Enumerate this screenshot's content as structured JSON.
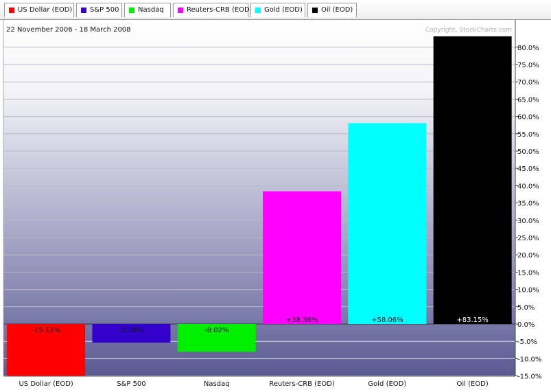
{
  "legend": [
    {
      "label": "US Dollar (EOD)",
      "color": "#ff0000"
    },
    {
      "label": "S&P 500",
      "color": "#3300cc"
    },
    {
      "label": "Nasdaq",
      "color": "#00ee00"
    },
    {
      "label": "Reuters-CRB (EOD)",
      "color": "#ff00ff"
    },
    {
      "label": "Gold (EOD)",
      "color": "#00ffff"
    },
    {
      "label": "Oil (EOD)",
      "color": "#000000"
    }
  ],
  "date_range": "22 November 2006 - 18 March 2008",
  "copyright": "Copyright, StockCharts.com",
  "chart_data": {
    "type": "bar",
    "categories": [
      "US Dollar (EOD)",
      "S&P 500",
      "Nasdaq",
      "Reuters-CRB (EOD)",
      "Gold (EOD)",
      "Oil (EOD)"
    ],
    "values": [
      -15.12,
      -5.36,
      -8.02,
      38.36,
      58.06,
      83.15
    ],
    "value_labels": [
      "-15.12%",
      "-5.36%",
      "-8.02%",
      "+38.36%",
      "+58.06%",
      "+83.15%"
    ],
    "colors": [
      "#ff0000",
      "#3300cc",
      "#00ee00",
      "#ff00ff",
      "#00ffff",
      "#000000"
    ],
    "yticks": [
      -15,
      -10,
      -5,
      0,
      5,
      10,
      15,
      20,
      25,
      30,
      35,
      40,
      45,
      50,
      55,
      60,
      65,
      70,
      75,
      80
    ],
    "ytick_labels": [
      "-15.0%",
      "-10.0%",
      "-5.0%",
      "0.0%",
      "5.0%",
      "10.0%",
      "15.0%",
      "20.0%",
      "25.0%",
      "30.0%",
      "35.0%",
      "40.0%",
      "45.0%",
      "50.0%",
      "55.0%",
      "60.0%",
      "65.0%",
      "70.0%",
      "75.0%",
      "80.0%"
    ],
    "ylim": [
      -15,
      80
    ],
    "grid": true,
    "legend_position": "top",
    "title": "",
    "xlabel": "",
    "ylabel": ""
  }
}
